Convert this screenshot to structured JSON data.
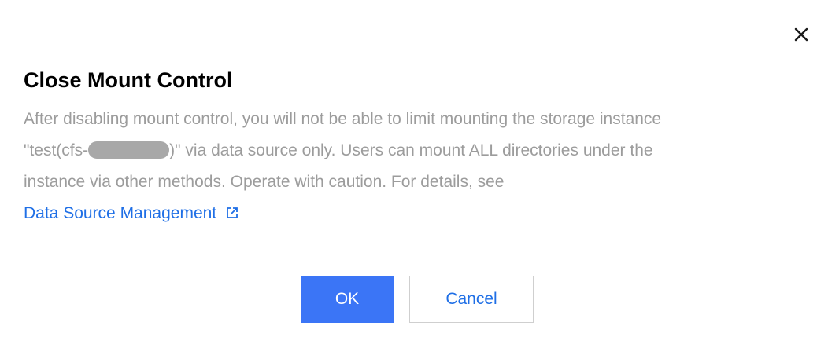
{
  "dialog": {
    "title": "Close Mount Control",
    "body": {
      "line1": "After disabling mount control, you will not be able to limit mounting the storage instance",
      "line2_prefix": "\"test(cfs-",
      "line2_suffix": ")\" via data source only. Users can mount ALL directories under the",
      "line3": "instance via other methods. Operate with caution. For details, see"
    },
    "link": {
      "label": "Data Source Management",
      "icon": "external-link-icon"
    },
    "buttons": {
      "ok_label": "OK",
      "cancel_label": "Cancel"
    },
    "close_icon": "close-icon"
  },
  "colors": {
    "title": "#000000",
    "body_text": "#9c9c9c",
    "link": "#1f6fe6",
    "primary_button": "#3b75f6",
    "cancel_border": "#cfcfcf"
  }
}
